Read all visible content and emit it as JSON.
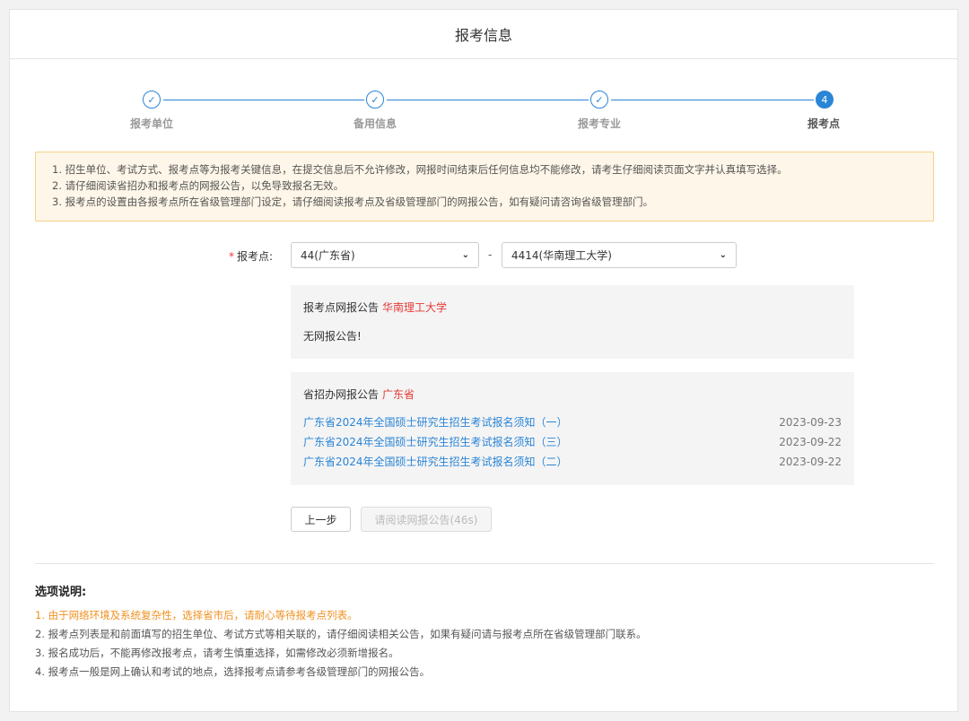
{
  "header": {
    "title": "报考信息"
  },
  "steps": [
    {
      "label": "报考单位",
      "marker": "✓"
    },
    {
      "label": "备用信息",
      "marker": "✓"
    },
    {
      "label": "报考专业",
      "marker": "✓"
    },
    {
      "label": "报考点",
      "marker": "4"
    }
  ],
  "notice": [
    "1. 招生单位、考试方式、报考点等为报考关键信息，在提交信息后不允许修改，网报时间结束后任何信息均不能修改，请考生仔细阅读页面文字并认真填写选择。",
    "2. 请仔细阅读省招办和报考点的网报公告，以免导致报名无效。",
    "3. 报考点的设置由各报考点所在省级管理部门设定，请仔细阅读报考点及省级管理部门的网报公告，如有疑问请咨询省级管理部门。"
  ],
  "form": {
    "required_mark": "*",
    "label": "报考点:",
    "province_select": "44(广东省)",
    "separator": "-",
    "site_select": "4414(华南理工大学)"
  },
  "site_panel": {
    "title": "报考点网报公告",
    "highlight": "华南理工大学",
    "empty_text": "无网报公告!"
  },
  "province_panel": {
    "title": "省招办网报公告",
    "highlight": "广东省",
    "announcements": [
      {
        "title": "广东省2024年全国硕士研究生招生考试报名须知（一）",
        "date": "2023-09-23"
      },
      {
        "title": "广东省2024年全国硕士研究生招生考试报名须知（三）",
        "date": "2023-09-22"
      },
      {
        "title": "广东省2024年全国硕士研究生招生考试报名须知（二）",
        "date": "2023-09-22"
      }
    ]
  },
  "buttons": {
    "prev": "上一步",
    "read": "请阅读网报公告(46s)"
  },
  "notes": {
    "title": "选项说明:",
    "lines": [
      "1. 由于网络环境及系统复杂性，选择省市后，请耐心等待报考点列表。",
      "2. 报考点列表是和前面填写的招生单位、考试方式等相关联的，请仔细阅读相关公告，如果有疑问请与报考点所在省级管理部门联系。",
      "3. 报名成功后，不能再修改报考点，请考生慎重选择，如需修改必须新增报名。",
      "4. 报考点一般是网上确认和考试的地点，选择报考点请参考各级管理部门的网报公告。"
    ]
  },
  "colors": {
    "accent": "#2b85d6",
    "danger": "#e53935",
    "warning": "#f0901f",
    "notice_bg": "#fef6e8"
  }
}
